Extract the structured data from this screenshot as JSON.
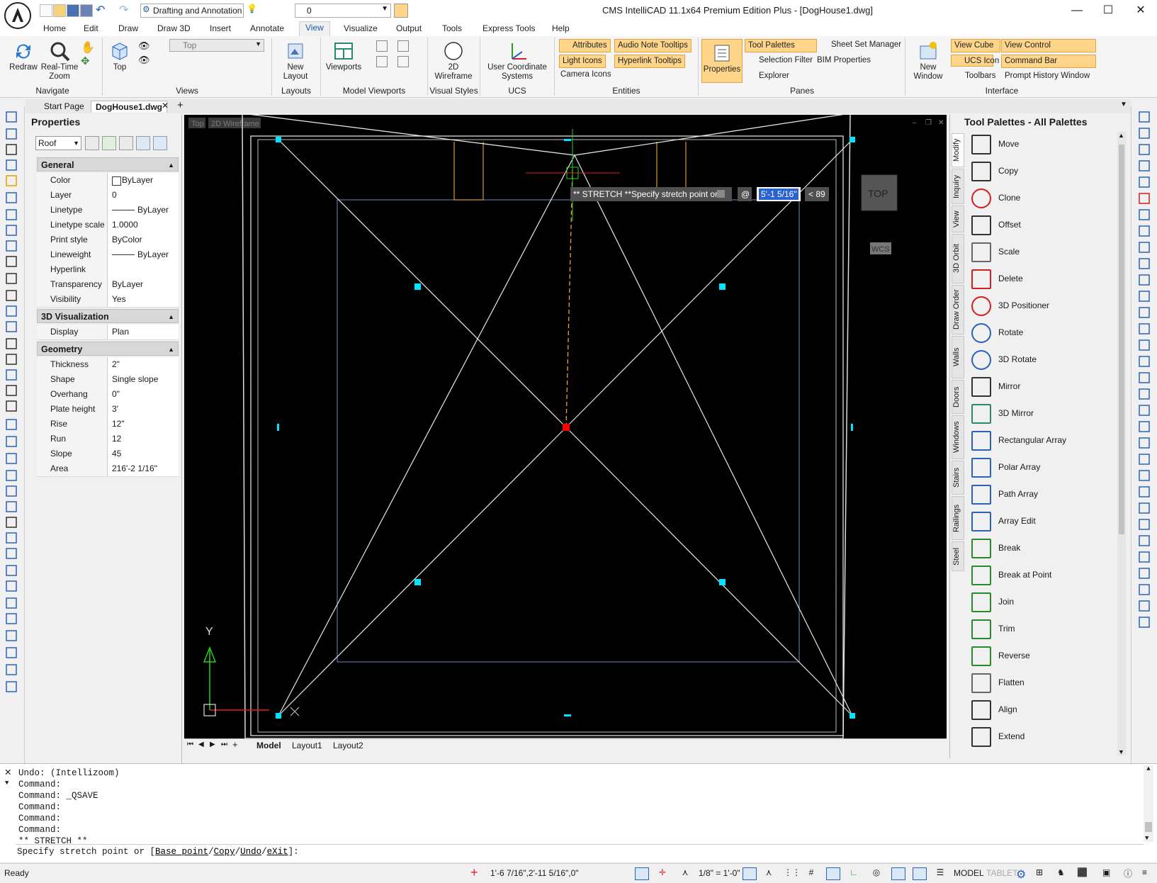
{
  "window": {
    "title": "CMS IntelliCAD 11.1x64 Premium Edition Plus  - [DogHouse1.dwg]",
    "workspace": "Drafting and Annotation",
    "layer_combo": "0"
  },
  "ribbon_tabs": [
    "Home",
    "Edit",
    "Draw",
    "Draw 3D",
    "Insert",
    "Annotate",
    "View",
    "Visualize",
    "Output",
    "Tools",
    "Express Tools",
    "Help"
  ],
  "ribbon": {
    "navigate": {
      "label": "Navigate",
      "redraw": "Redraw",
      "realtime_zoom": "Real-Time Zoom"
    },
    "views": {
      "label": "Views",
      "top": "Top",
      "view_combo": "Top"
    },
    "layouts": {
      "label": "Layouts",
      "new_layout": "New Layout"
    },
    "model_viewports": {
      "label": "Model Viewports",
      "viewports": "Viewports"
    },
    "visual_styles": {
      "label": "Visual Styles",
      "wireframe": "2D Wireframe"
    },
    "ucs": {
      "label": "UCS",
      "ucs_btn": "User Coordinate Systems"
    },
    "entities": {
      "label": "Entities",
      "attributes": "Attributes",
      "audio_note": "Audio Note Tooltips",
      "light_icons": "Light Icons",
      "hyperlink": "Hyperlink Tooltips",
      "camera": "Camera Icons"
    },
    "panes": {
      "label": "Panes",
      "properties": "Properties",
      "tool_palettes": "Tool Palettes",
      "sheet_set": "Sheet Set Manager",
      "selection_filter": "Selection Filter",
      "bim_properties": "BIM Properties",
      "explorer": "Explorer"
    },
    "interface": {
      "label": "Interface",
      "new_window": "New Window",
      "view_cube": "View Cube",
      "view_control": "View Control",
      "ucs_icon": "UCS Icon",
      "command_bar": "Command Bar",
      "toolbars": "Toolbars",
      "prompt_history": "Prompt History Window"
    }
  },
  "doc_tabs": [
    "Start Page",
    "DogHouse1.dwg"
  ],
  "properties": {
    "title": "Properties",
    "selection": "Roof",
    "groups": [
      {
        "name": "General",
        "rows": [
          [
            "Color",
            "ByLayer"
          ],
          [
            "Layer",
            "0"
          ],
          [
            "Linetype",
            "ByLayer"
          ],
          [
            "Linetype scale",
            "1.0000"
          ],
          [
            "Print style",
            "ByColor"
          ],
          [
            "Lineweight",
            "ByLayer"
          ],
          [
            "Hyperlink",
            ""
          ],
          [
            "Transparency",
            "ByLayer"
          ],
          [
            "Visibility",
            "Yes"
          ]
        ]
      },
      {
        "name": "3D Visualization",
        "rows": [
          [
            "Display represe...",
            "Plan"
          ]
        ]
      },
      {
        "name": "Geometry",
        "rows": [
          [
            "Thickness",
            "2\""
          ],
          [
            "Shape",
            "Single slope"
          ],
          [
            "Overhang",
            "0\""
          ],
          [
            "Plate height",
            "3'"
          ],
          [
            "Rise",
            "12\""
          ],
          [
            "Run",
            "12"
          ],
          [
            "Slope",
            "45"
          ],
          [
            "Area",
            "216'-2 1/16\""
          ]
        ]
      }
    ]
  },
  "viewport": {
    "view_label": "Top",
    "style_label": "2D Wireframe",
    "cube_label": "TOP",
    "wcs_label": "WCS",
    "ucs_y": "Y",
    "stretch_prompt": "** STRETCH **Specify stretch point or",
    "at_symbol": "@",
    "length_value": "5'-1 5/16\"",
    "angle_value": "< 89",
    "layout_tabs": [
      "Model",
      "Layout1",
      "Layout2"
    ]
  },
  "tool_palettes": {
    "title": "Tool Palettes - All Palettes",
    "side_tabs": [
      "Modify",
      "Inquiry",
      "View",
      "3D Orbit",
      "Draw Order",
      "Walls",
      "Doors",
      "Windows",
      "Stairs",
      "Railings",
      "Steel"
    ],
    "tools": [
      "Move",
      "Copy",
      "Clone",
      "Offset",
      "Scale",
      "Delete",
      "3D Positioner",
      "Rotate",
      "3D Rotate",
      "Mirror",
      "3D Mirror",
      "Rectangular Array",
      "Polar Array",
      "Path Array",
      "Array Edit",
      "Break",
      "Break at Point",
      "Join",
      "Trim",
      "Reverse",
      "Flatten",
      "Align",
      "Extend"
    ]
  },
  "command_history": [
    "Undo: (Intellizoom)",
    "Command:",
    "Command: _QSAVE",
    "Command:",
    "Command:",
    "Command:",
    "** STRETCH **"
  ],
  "command_prompt": {
    "prefix": "Specify stretch point or [",
    "opt1": "Base point",
    "opt2": "Copy",
    "opt3": "Undo",
    "opt4": "eXit",
    "suffix": "]:"
  },
  "status": {
    "ready": "Ready",
    "coords": "1'-6 7/16\",2'-11 5/16\",0\"",
    "scale": "1/8\" = 1'-0\"",
    "model": "MODEL",
    "tablet": "TABLET"
  },
  "colors": {
    "accent": "#1b5bb0",
    "highlight": "#ffd58a",
    "grip": "#00e5ff",
    "hot_grip": "#ff0000"
  }
}
